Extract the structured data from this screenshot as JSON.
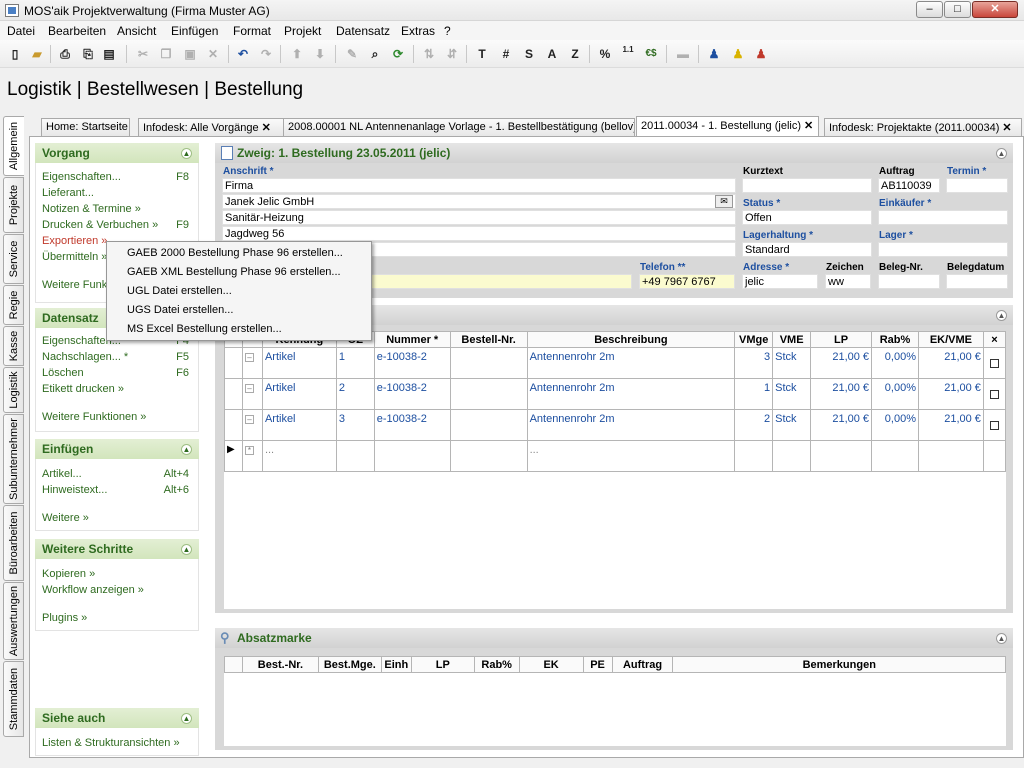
{
  "window": {
    "title": "MOS'aik Projektverwaltung (Firma Muster AG)",
    "min": "–",
    "max": "□",
    "close": "✕"
  },
  "menubar": [
    "Datei",
    "Bearbeiten",
    "Ansicht",
    "Einfügen",
    "Format",
    "Projekt",
    "Datensatz",
    "Extras",
    "?"
  ],
  "toolbar": {
    "icons": [
      "new-file",
      "open-folder",
      "print",
      "print-preview",
      "cut",
      "copy",
      "paste",
      "delete",
      "undo",
      "redo",
      "move-up",
      "move-down",
      "edit",
      "search",
      "refresh",
      "sort",
      "T",
      "#",
      "S",
      "A",
      "Z",
      "%",
      "1.1",
      "€",
      "format",
      "user-blue",
      "user-yellow",
      "user-red"
    ],
    "texts": {
      "t": "T",
      "hash": "#",
      "s": "S",
      "a": "A",
      "z": "Z",
      "pct": "%",
      "num": "1.1",
      "euro": "€$"
    }
  },
  "page_title": "Logistik | Bestellwesen | Bestellung",
  "vertical_tabs": [
    "Allgemein",
    "Projekte",
    "Service",
    "Regie",
    "Kasse",
    "Logistik",
    "Subunternehmer",
    "Büroarbeiten",
    "Auswertungen",
    "Stammdaten"
  ],
  "doc_tabs": [
    {
      "label": "Home: Startseite",
      "close": ""
    },
    {
      "label": "Infodesk: Alle Vorgänge",
      "close": "✕"
    },
    {
      "label": "2008.00001 NL Antennenanlage Vorlage - 1. Bestellbestätigung (bellov)",
      "close": ""
    },
    {
      "label": "2011.00034 - 1. Bestellung (jelic)",
      "close": "✕"
    },
    {
      "label": "Infodesk: Projektakte (2011.00034)",
      "close": "✕"
    }
  ],
  "panels": {
    "vorgang": {
      "title": "Vorgang",
      "items": [
        {
          "label": "Eigenschaften...",
          "key": "F8"
        },
        {
          "label": "Lieferant...",
          "key": ""
        },
        {
          "label": "Notizen & Termine »",
          "key": ""
        },
        {
          "label": "Drucken & Verbuchen »",
          "key": "F9"
        },
        {
          "label": "Exportieren »",
          "key": ""
        },
        {
          "label": "Übermitteln »",
          "key": ""
        }
      ],
      "more": "Weitere Funk"
    },
    "datensatz": {
      "title": "Datensatz",
      "items": [
        {
          "label": "Eigenschaften...",
          "key": "F4"
        },
        {
          "label": "Nachschlagen... *",
          "key": "F5"
        },
        {
          "label": "Löschen",
          "key": "F6"
        },
        {
          "label": "Etikett drucken »",
          "key": ""
        }
      ],
      "more": "Weitere Funktionen »"
    },
    "einfuegen": {
      "title": "Einfügen",
      "items": [
        {
          "label": "Artikel...",
          "key": "Alt+4"
        },
        {
          "label": "Hinweistext...",
          "key": "Alt+6"
        }
      ],
      "more": "Weitere »"
    },
    "schritte": {
      "title": "Weitere Schritte",
      "items": [
        {
          "label": "Kopieren »"
        },
        {
          "label": "Workflow anzeigen »"
        }
      ],
      "more": "Plugins »"
    },
    "siehe": {
      "title": "Siehe auch",
      "items": [
        {
          "label": "Listen & Strukturansichten »"
        }
      ]
    }
  },
  "zweig": {
    "title": "Zweig: 1. Bestellung 23.05.2011 (jelic)",
    "anschrift_label": "Anschrift *",
    "anschrift": [
      "Firma",
      "Janek Jelic GmbH",
      "Sanitär-Heizung",
      "Jagdweg 56",
      ""
    ],
    "telefon_label": "Telefon **",
    "telefon": "+49 7967 6767",
    "kurztext_label": "Kurztext",
    "kurztext": "",
    "auftrag_label": "Auftrag",
    "auftrag": "AB110039",
    "termin_label": "Termin *",
    "termin": "",
    "status_label": "Status *",
    "status": "Offen",
    "einkaeufer_label": "Einkäufer *",
    "einkaeufer": "",
    "lagerhaltung_label": "Lagerhaltung *",
    "lagerhaltung": "Standard",
    "lager_label": "Lager *",
    "lager": "",
    "adresse_label": "Adresse *",
    "adresse": "jelic",
    "zeichen_label": "Zeichen",
    "zeichen": "ww",
    "belegnr_label": "Beleg-Nr.",
    "belegnr": "",
    "belegdatum_label": "Belegdatum",
    "belegdatum": ""
  },
  "positions": {
    "headers": [
      "Kennung",
      "OZ",
      "Nummer *",
      "Bestell-Nr.",
      "Beschreibung",
      "VMge",
      "VME",
      "LP",
      "Rab%",
      "EK/VME",
      "×"
    ],
    "rows": [
      {
        "kennung": "Artikel",
        "oz": "1",
        "nummer": "e-10038-2",
        "bestellnr": "",
        "beschreibung": "Antennenrohr 2m",
        "vmge": "3",
        "vme": "Stck",
        "lp": "21,00 €",
        "rab": "0,00%",
        "ek": "21,00 €"
      },
      {
        "kennung": "Artikel",
        "oz": "2",
        "nummer": "e-10038-2",
        "bestellnr": "",
        "beschreibung": "Antennenrohr 2m",
        "vmge": "1",
        "vme": "Stck",
        "lp": "21,00 €",
        "rab": "0,00%",
        "ek": "21,00 €"
      },
      {
        "kennung": "Artikel",
        "oz": "3",
        "nummer": "e-10038-2",
        "bestellnr": "",
        "beschreibung": "Antennenrohr 2m",
        "vmge": "2",
        "vme": "Stck",
        "lp": "21,00 €",
        "rab": "0,00%",
        "ek": "21,00 €"
      }
    ],
    "new_row": {
      "kennung": "...",
      "beschreibung": "..."
    }
  },
  "absatzmarke": {
    "title": "Absatzmarke",
    "headers": [
      "Best.-Nr.",
      "Best.Mge.",
      "Einh",
      "LP",
      "Rab%",
      "EK",
      "PE",
      "Auftrag",
      "Bemerkungen"
    ]
  },
  "popup": [
    "GAEB 2000 Bestellung Phase 96 erstellen...",
    "GAEB XML Bestellung Phase 96 erstellen...",
    "UGL Datei erstellen...",
    "UGS Datei erstellen...",
    "MS Excel Bestellung erstellen..."
  ],
  "colors": {
    "panel_green": "#2f6b20",
    "link_blue": "#1d4fa0",
    "header_green_bg": "#d2e5bc"
  }
}
